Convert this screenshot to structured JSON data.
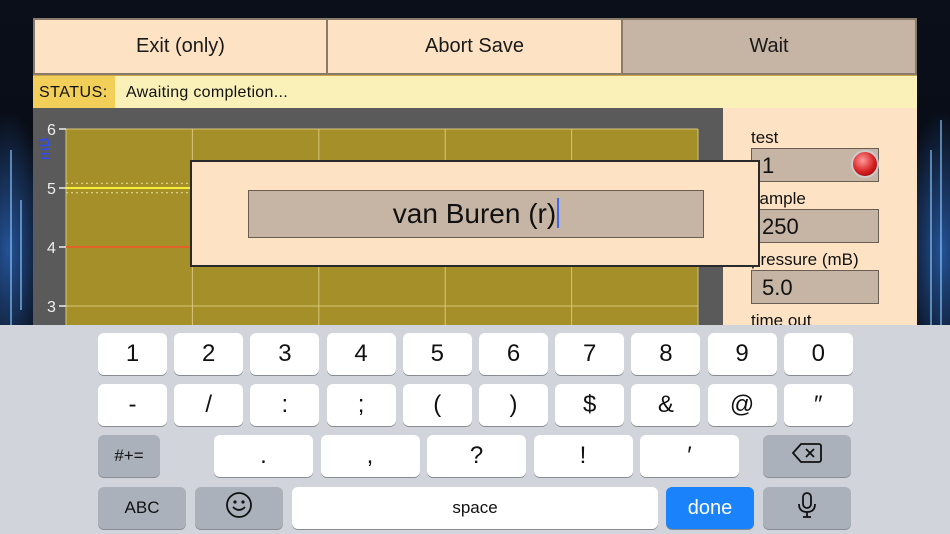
{
  "toolbar": {
    "exit_label": "Exit (only)",
    "abort_label": "Abort Save",
    "wait_label": "Wait"
  },
  "status": {
    "label": "STATUS:",
    "text": "Awaiting completion..."
  },
  "chart": {
    "y_axis_label": "mB",
    "y_ticks": [
      "6",
      "5",
      "4",
      "3"
    ],
    "colors": {
      "plot_background": "#a58f28",
      "grid": "#d8c67a",
      "line_yellow": "#f5ef3a",
      "line_orange": "#e0632a"
    }
  },
  "chart_data": {
    "type": "line",
    "ylabel": "mB",
    "ylim": [
      2.7,
      6
    ],
    "y_ticks": [
      3,
      4,
      5,
      6
    ],
    "grid": true,
    "series": [
      {
        "values": [
          5.0,
          5.0,
          5.0,
          5.0,
          5.0
        ]
      },
      {
        "values": [
          4.0,
          4.0
        ]
      }
    ]
  },
  "params": {
    "test_label": "test",
    "test_value": "1",
    "sample_label": "sample",
    "sample_value": "250",
    "pressure_label": "pressure (mB)",
    "pressure_value": "5.0",
    "timeout_label": "time out"
  },
  "modal": {
    "input_value": "van Buren (r)"
  },
  "keyboard": {
    "row1": [
      "1",
      "2",
      "3",
      "4",
      "5",
      "6",
      "7",
      "8",
      "9",
      "0"
    ],
    "row2": [
      "-",
      "/",
      ":",
      ";",
      "(",
      ")",
      "$",
      "&",
      "@",
      "″"
    ],
    "row3_mode": "#+=",
    "row3": [
      ".",
      ",",
      "?",
      "!",
      "′"
    ],
    "abc_label": "ABC",
    "space_label": "space",
    "done_label": "done",
    "icons": {
      "backspace": "backspace-icon",
      "emoji": "emoji-icon",
      "mic": "microphone-icon"
    }
  }
}
